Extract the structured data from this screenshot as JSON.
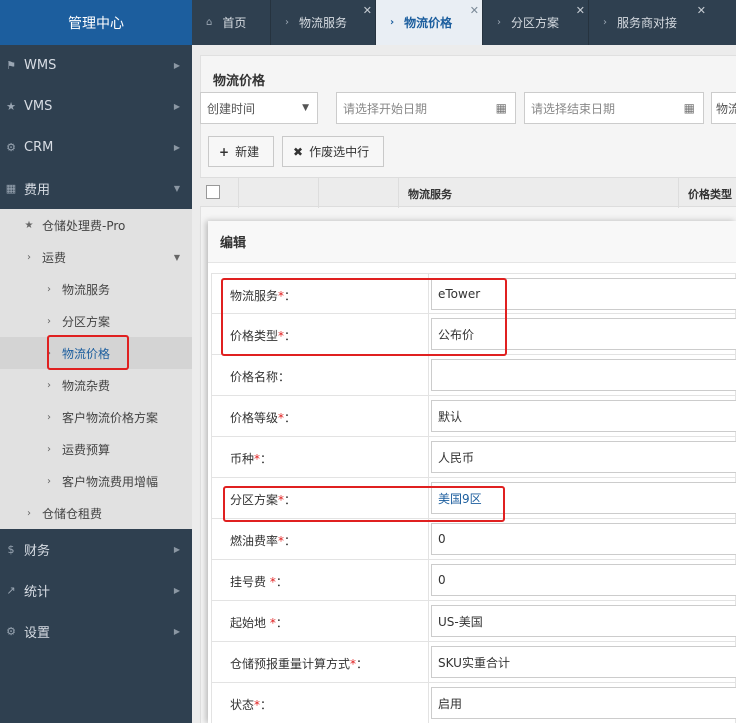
{
  "sidebar": {
    "brand": "管理中心",
    "top_items": [
      {
        "label": "WMS",
        "icon": "bank-icon"
      },
      {
        "label": "VMS",
        "icon": "star-icon"
      },
      {
        "label": "CRM",
        "icon": "gear-icon"
      },
      {
        "label": "费用",
        "icon": "grid-icon"
      }
    ],
    "sub_items": [
      {
        "label": "仓储处理费-Pro"
      },
      {
        "label": "运费"
      },
      {
        "label": "物流服务"
      },
      {
        "label": "分区方案"
      },
      {
        "label": "物流价格"
      },
      {
        "label": "物流杂费"
      },
      {
        "label": "客户物流价格方案"
      },
      {
        "label": "运费预算"
      },
      {
        "label": "客户物流费用增幅"
      },
      {
        "label": "仓储仓租费"
      }
    ],
    "bottom_items": [
      {
        "label": "财务",
        "icon": "dollar-icon"
      },
      {
        "label": "统计",
        "icon": "chart-icon"
      },
      {
        "label": "设置",
        "icon": "gear-icon"
      }
    ]
  },
  "tabs": [
    {
      "label": "首页"
    },
    {
      "label": "物流服务"
    },
    {
      "label": "物流价格"
    },
    {
      "label": "分区方案"
    },
    {
      "label": "服务商对接"
    }
  ],
  "main": {
    "title": "物流价格",
    "filter_select": "创建时间",
    "start_date_placeholder": "请选择开始日期",
    "end_date_placeholder": "请选择结束日期",
    "extra_filter": "物流",
    "new_button": "新建",
    "void_button": "作废选中行",
    "columns": [
      "物流服务",
      "价格类型"
    ]
  },
  "modal": {
    "title": "编辑",
    "fields": [
      {
        "label": "物流服务",
        "req": "*",
        "value": "eTower"
      },
      {
        "label": "价格类型",
        "req": "*",
        "value": "公布价"
      },
      {
        "label": "价格名称",
        "req": "",
        "value": ""
      },
      {
        "label": "价格等级",
        "req": "*",
        "value": "默认"
      },
      {
        "label": "币种",
        "req": "*",
        "value": "人民币"
      },
      {
        "label": "分区方案",
        "req": "*",
        "value": "美国9区"
      },
      {
        "label": "燃油费率",
        "req": "*",
        "value": "0"
      },
      {
        "label": "挂号费 ",
        "req": "*",
        "value": "0"
      },
      {
        "label": "起始地 ",
        "req": "*",
        "value": "US-美国"
      },
      {
        "label": "仓储预报重量计算方式",
        "req": "*",
        "value": "SKU实重合计"
      },
      {
        "label": "状态",
        "req": "*",
        "value": "启用"
      }
    ],
    "colon": "："
  }
}
